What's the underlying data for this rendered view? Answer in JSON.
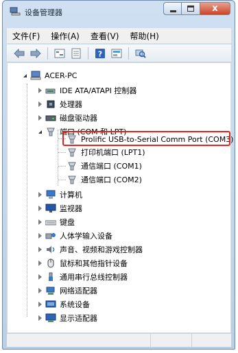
{
  "window": {
    "title": "设备管理器",
    "close_glyph": "x"
  },
  "menubar": {
    "items": [
      "文件(F)",
      "操作(A)",
      "查看(V)",
      "帮助(H)"
    ]
  },
  "tree": {
    "root": "ACER-PC",
    "categories": [
      {
        "label": "IDE ATA/ATAPI 控制器",
        "icon": "ide-controller-icon",
        "expanded": false
      },
      {
        "label": "处理器",
        "icon": "processor-icon",
        "expanded": false
      },
      {
        "label": "磁盘驱动器",
        "icon": "disk-drive-icon",
        "expanded": false
      },
      {
        "label": "端口 (COM 和 LPT)",
        "icon": "port-icon",
        "expanded": true
      },
      {
        "label": "计算机",
        "icon": "computer-icon",
        "expanded": false
      },
      {
        "label": "监视器",
        "icon": "monitor-icon",
        "expanded": false
      },
      {
        "label": "键盘",
        "icon": "keyboard-icon",
        "expanded": false
      },
      {
        "label": "人体学输入设备",
        "icon": "hid-icon",
        "expanded": false
      },
      {
        "label": "声音、视频和游戏控制器",
        "icon": "sound-icon",
        "expanded": false
      },
      {
        "label": "鼠标和其他指针设备",
        "icon": "mouse-icon",
        "expanded": false
      },
      {
        "label": "通用串行总线控制器",
        "icon": "usb-icon",
        "expanded": false
      },
      {
        "label": "网络适配器",
        "icon": "network-icon",
        "expanded": false
      },
      {
        "label": "系统设备",
        "icon": "system-icon",
        "expanded": false
      },
      {
        "label": "显示适配器",
        "icon": "display-icon",
        "expanded": false
      }
    ],
    "ports": [
      "Prolific USB-to-Serial Comm Port (COM3)",
      "打印机端口 (LPT1)",
      "通信端口 (COM1)",
      "通信端口 (COM2)"
    ]
  },
  "colors": {
    "highlight": "#e0231c",
    "titlebar": "#cfe0f2"
  }
}
